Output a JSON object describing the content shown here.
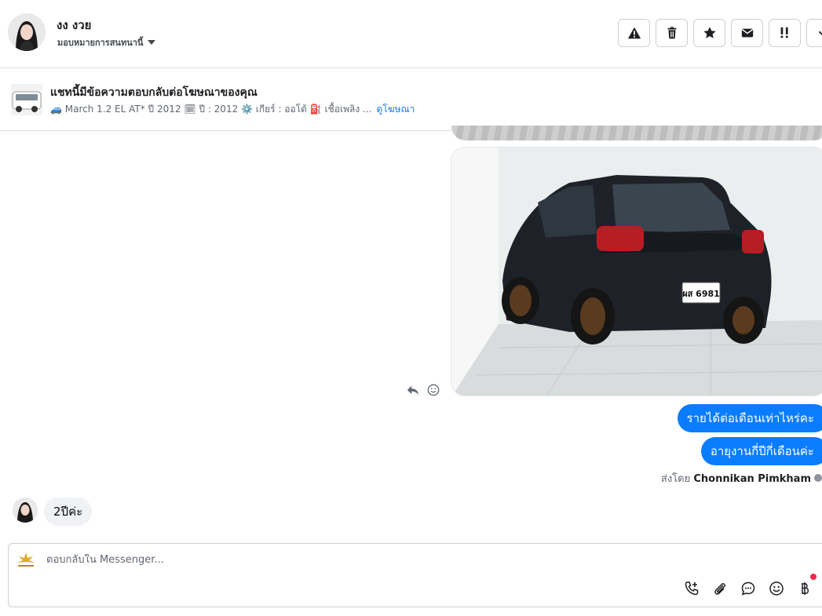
{
  "header": {
    "contact_name": "งง งวย",
    "assign_label": "มอบหมายการสนทนานี้",
    "tools": [
      {
        "name": "report-icon"
      },
      {
        "name": "trash-icon"
      },
      {
        "name": "star-icon"
      },
      {
        "name": "mail-icon"
      },
      {
        "name": "important-icon"
      },
      {
        "name": "chevron-down-icon"
      }
    ]
  },
  "ad": {
    "title": "แชทนี้มีข้อความตอบกลับต่อโฆษณาของคุณ",
    "description": "🚙 March 1.2 EL AT* ปี 2012 🗓 ปี : 2012 ⚙️ เกียร์ : ออโต้ ⛽ เชื้อเพลิง ...",
    "link": "ดูโฆษณา"
  },
  "messages": {
    "outgoing": [
      "รายได้ต่อเดือนเท่าไหร่คะ",
      "อายุงานกี่ปีกี่เดือนค่ะ"
    ],
    "sent_by_prefix": "ส่งโดย",
    "sent_by_name": "Chonnikan Pimkham",
    "incoming": "2ปีค่ะ",
    "plate_text": "ผส 6981"
  },
  "composer": {
    "placeholder": "ตอบกลับใน Messenger...",
    "tools": [
      "add-call-icon",
      "attachment-icon",
      "saved-replies-icon",
      "emoji-icon",
      "baht-icon"
    ]
  },
  "colors": {
    "accent": "#0a7cff",
    "link": "#1877f2",
    "notification": "#f02849",
    "border": "#dddfe2"
  }
}
